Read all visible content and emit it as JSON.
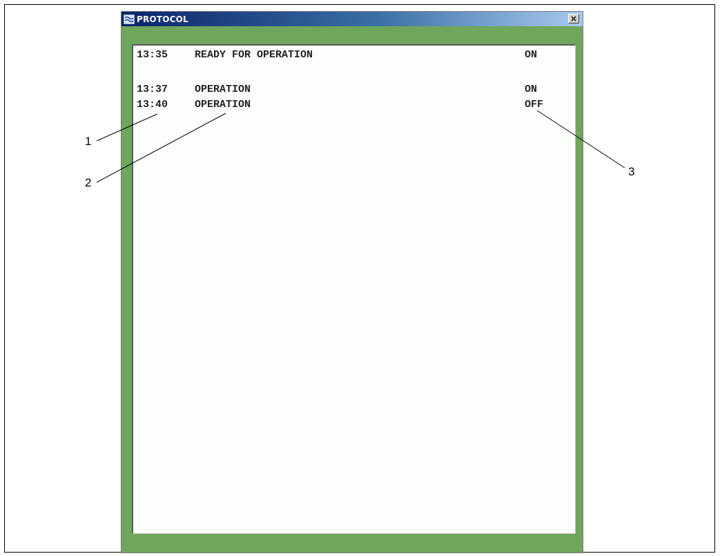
{
  "window": {
    "title": "PROTOCOL",
    "close_label": "×",
    "icon": "app-wave-icon",
    "colors": {
      "frame": "#6ea65c",
      "panel": "#fcfffc",
      "titlebar_start": "#0a246a",
      "titlebar_end": "#a6caf0"
    }
  },
  "log": {
    "entries": [
      {
        "time": "13:35",
        "event": "READY FOR OPERATION",
        "state": "ON"
      },
      {
        "time": "13:37",
        "event": "OPERATION",
        "state": "ON"
      },
      {
        "time": "13:40",
        "event": "OPERATION",
        "state": "OFF"
      }
    ]
  },
  "callouts": [
    {
      "label": "1"
    },
    {
      "label": "2"
    },
    {
      "label": "3"
    }
  ]
}
